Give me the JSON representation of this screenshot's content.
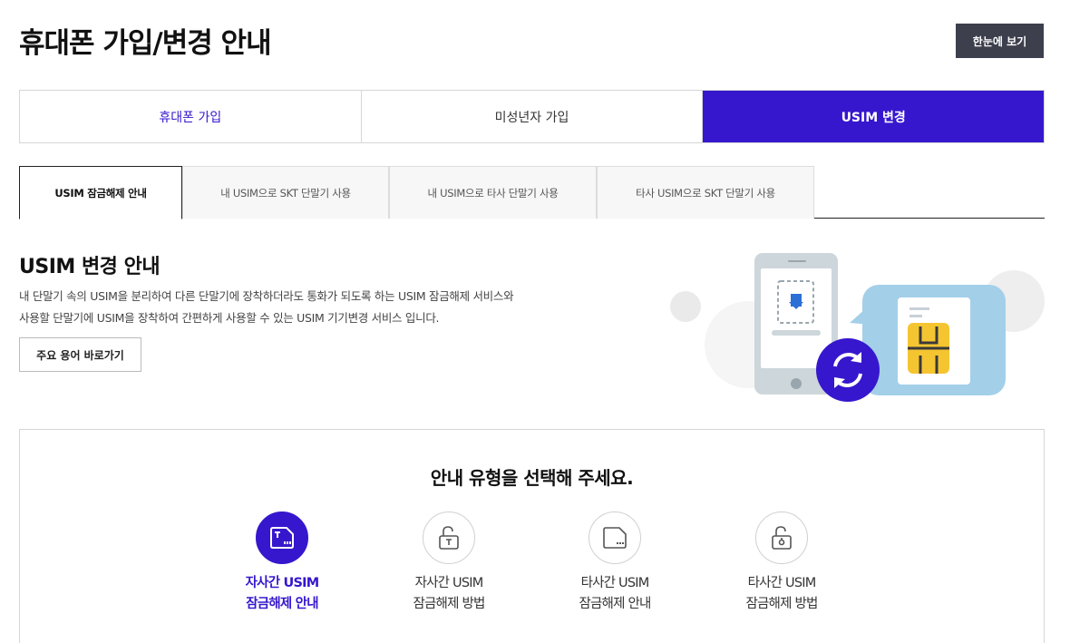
{
  "page_title": "휴대폰 가입/변경 안내",
  "overview_button": "한눈에 보기",
  "main_tabs": [
    {
      "label": "휴대폰 가입"
    },
    {
      "label": "미성년자 가입"
    },
    {
      "label": "USIM 변경"
    }
  ],
  "sub_tabs": [
    {
      "label": "USIM 잠금해제 안내"
    },
    {
      "label": "내 USIM으로 SKT 단말기 사용"
    },
    {
      "label": "내 USIM으로 타사 단말기 사용"
    },
    {
      "label": "타사 USIM으로 SKT 단말기 사용"
    }
  ],
  "section": {
    "title": "USIM 변경 안내",
    "desc_line1": "내 단말기 속의 USIM을 분리하여 다른 단말기에 장착하더라도 통화가 되도록 하는 USIM 잠금해제 서비스와",
    "desc_line2": "사용할 단말기에 USIM을 장착하여 간편하게 사용할 수 있는 USIM 기기변경 서비스 입니다.",
    "term_button": "주요 용어 바로가기"
  },
  "selector": {
    "title": "안내 유형을 선택해 주세요.",
    "options": [
      {
        "line1": "자사간 USIM",
        "line2": "잠금해제 안내",
        "icon": "sim-card-icon"
      },
      {
        "line1": "자사간 USIM",
        "line2": "잠금해제 방법",
        "icon": "unlock-t-icon"
      },
      {
        "line1": "타사간 USIM",
        "line2": "잠금해제 안내",
        "icon": "sim-card-icon"
      },
      {
        "line1": "타사간 USIM",
        "line2": "잠금해제 방법",
        "icon": "unlock-icon"
      }
    ]
  },
  "colors": {
    "accent": "#3617cd",
    "dark_button": "#3d3f4d",
    "sim_gold": "#f5c531",
    "sim_bubble": "#a3cfe9"
  }
}
